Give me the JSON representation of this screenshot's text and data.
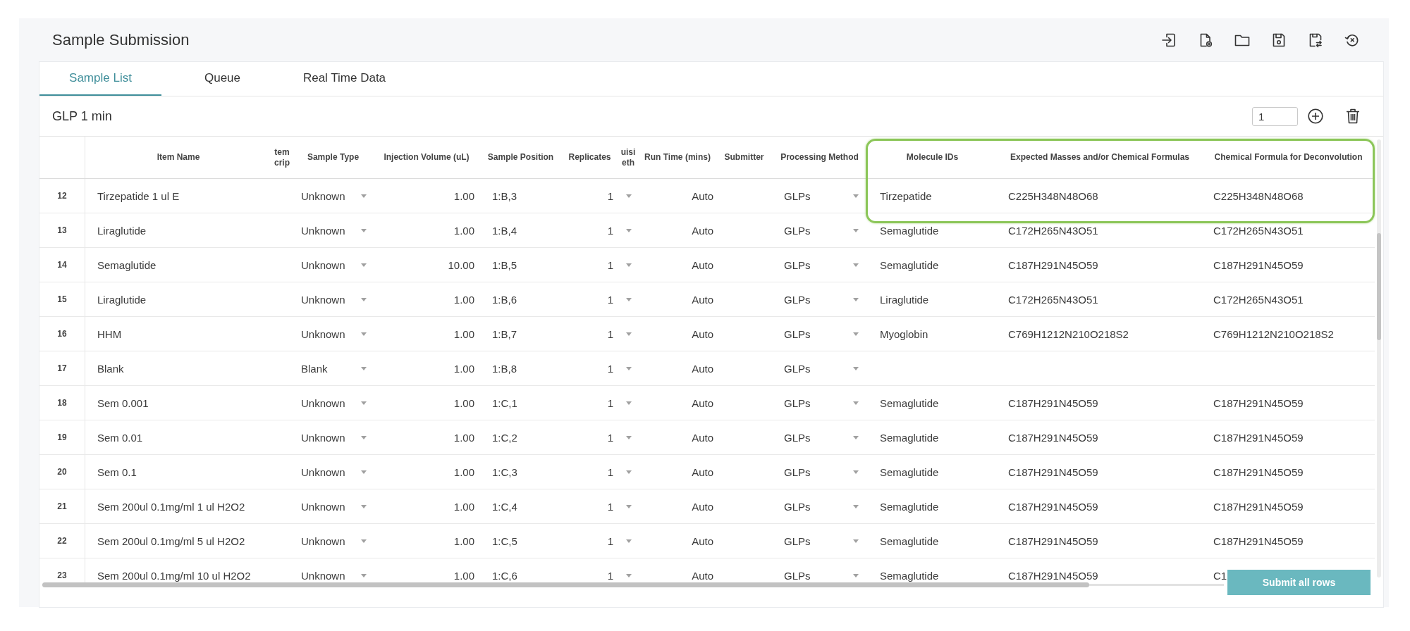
{
  "window": {
    "title": "Sample Submission"
  },
  "tabs": [
    {
      "label": "Sample List",
      "selected": true
    },
    {
      "label": "Queue",
      "selected": false
    },
    {
      "label": "Real Time Data",
      "selected": false
    }
  ],
  "list": {
    "name": "GLP 1 min",
    "count_field": {
      "value": "1"
    }
  },
  "table": {
    "columns": [
      {
        "label": "Item Name",
        "kind": "text"
      },
      {
        "label": "tem crip",
        "kind": "text"
      },
      {
        "label": "Sample Type",
        "kind": "select"
      },
      {
        "label": "Injection Volume (uL)",
        "kind": "number"
      },
      {
        "label": "Sample Position",
        "kind": "text"
      },
      {
        "label": "Replicates",
        "kind": "number"
      },
      {
        "label": "uisi eth",
        "kind": "select"
      },
      {
        "label": "Run Time (mins)",
        "kind": "number"
      },
      {
        "label": "Submitter",
        "kind": "text"
      },
      {
        "label": "Processing Method",
        "kind": "select"
      },
      {
        "label": "Molecule IDs",
        "kind": "text"
      },
      {
        "label": "Expected Masses and/or Chemical Formulas",
        "kind": "text"
      },
      {
        "label": "Chemical Formula for Deconvolution",
        "kind": "text"
      }
    ],
    "rows": [
      {
        "number": "12",
        "item_name": "Tirzepatide 1 ul E",
        "sample_type": "Unknown",
        "injection_volume": "1.00",
        "sample_position": "1:B,3",
        "replicates": "1",
        "run_time": "Auto",
        "processing_method": "GLPs",
        "molecule_ids": "Tirzepatide",
        "expected_masses": "C225H348N48O68",
        "deconvolution_formula": "C225H348N48O68"
      },
      {
        "number": "13",
        "item_name": "Liraglutide",
        "sample_type": "Unknown",
        "injection_volume": "1.00",
        "sample_position": "1:B,4",
        "replicates": "1",
        "run_time": "Auto",
        "processing_method": "GLPs",
        "molecule_ids": "Semaglutide",
        "expected_masses": "C172H265N43O51",
        "deconvolution_formula": "C172H265N43O51"
      },
      {
        "number": "14",
        "item_name": "Semaglutide",
        "sample_type": "Unknown",
        "injection_volume": "10.00",
        "sample_position": "1:B,5",
        "replicates": "1",
        "run_time": "Auto",
        "processing_method": "GLPs",
        "molecule_ids": "Semaglutide",
        "expected_masses": "C187H291N45O59",
        "deconvolution_formula": "C187H291N45O59"
      },
      {
        "number": "15",
        "item_name": "Liraglutide",
        "sample_type": "Unknown",
        "injection_volume": "1.00",
        "sample_position": "1:B,6",
        "replicates": "1",
        "run_time": "Auto",
        "processing_method": "GLPs",
        "molecule_ids": "Liraglutide",
        "expected_masses": "C172H265N43O51",
        "deconvolution_formula": "C172H265N43O51"
      },
      {
        "number": "16",
        "item_name": "HHM",
        "sample_type": "Unknown",
        "injection_volume": "1.00",
        "sample_position": "1:B,7",
        "replicates": "1",
        "run_time": "Auto",
        "processing_method": "GLPs",
        "molecule_ids": "Myoglobin",
        "expected_masses": "C769H1212N210O218S2",
        "deconvolution_formula": "C769H1212N210O218S2"
      },
      {
        "number": "17",
        "item_name": "Blank",
        "sample_type": "Blank",
        "injection_volume": "1.00",
        "sample_position": "1:B,8",
        "replicates": "1",
        "run_time": "Auto",
        "processing_method": "GLPs"
      },
      {
        "number": "18",
        "item_name": "Sem 0.001",
        "sample_type": "Unknown",
        "injection_volume": "1.00",
        "sample_position": "1:C,1",
        "replicates": "1",
        "run_time": "Auto",
        "processing_method": "GLPs",
        "molecule_ids": "Semaglutide",
        "expected_masses": "C187H291N45O59",
        "deconvolution_formula": "C187H291N45O59"
      },
      {
        "number": "19",
        "item_name": "Sem 0.01",
        "sample_type": "Unknown",
        "injection_volume": "1.00",
        "sample_position": "1:C,2",
        "replicates": "1",
        "run_time": "Auto",
        "processing_method": "GLPs",
        "molecule_ids": "Semaglutide",
        "expected_masses": "C187H291N45O59",
        "deconvolution_formula": "C187H291N45O59"
      },
      {
        "number": "20",
        "item_name": "Sem 0.1",
        "sample_type": "Unknown",
        "injection_volume": "1.00",
        "sample_position": "1:C,3",
        "replicates": "1",
        "run_time": "Auto",
        "processing_method": "GLPs",
        "molecule_ids": "Semaglutide",
        "expected_masses": "C187H291N45O59",
        "deconvolution_formula": "C187H291N45O59"
      },
      {
        "number": "21",
        "item_name": "Sem 200ul 0.1mg/ml 1 ul H2O2",
        "sample_type": "Unknown",
        "injection_volume": "1.00",
        "sample_position": "1:C,4",
        "replicates": "1",
        "run_time": "Auto",
        "processing_method": "GLPs",
        "molecule_ids": "Semaglutide",
        "expected_masses": "C187H291N45O59",
        "deconvolution_formula": "C187H291N45O59"
      },
      {
        "number": "22",
        "item_name": "Sem 200ul 0.1mg/ml 5 ul H2O2",
        "sample_type": "Unknown",
        "injection_volume": "1.00",
        "sample_position": "1:C,5",
        "replicates": "1",
        "run_time": "Auto",
        "processing_method": "GLPs",
        "molecule_ids": "Semaglutide",
        "expected_masses": "C187H291N45O59",
        "deconvolution_formula": "C187H291N45O59"
      },
      {
        "number": "23",
        "item_name": "Sem 200ul 0.1mg/ml 10 ul H2O2",
        "sample_type": "Unknown",
        "injection_volume": "1.00",
        "sample_position": "1:C,6",
        "replicates": "1",
        "run_time": "Auto",
        "processing_method": "GLPs",
        "molecule_ids": "Semaglutide",
        "expected_masses": "C187H291N45O59",
        "deconvolution_formula": "C1"
      }
    ]
  },
  "submit_button": {
    "label": "Submit all rows"
  }
}
